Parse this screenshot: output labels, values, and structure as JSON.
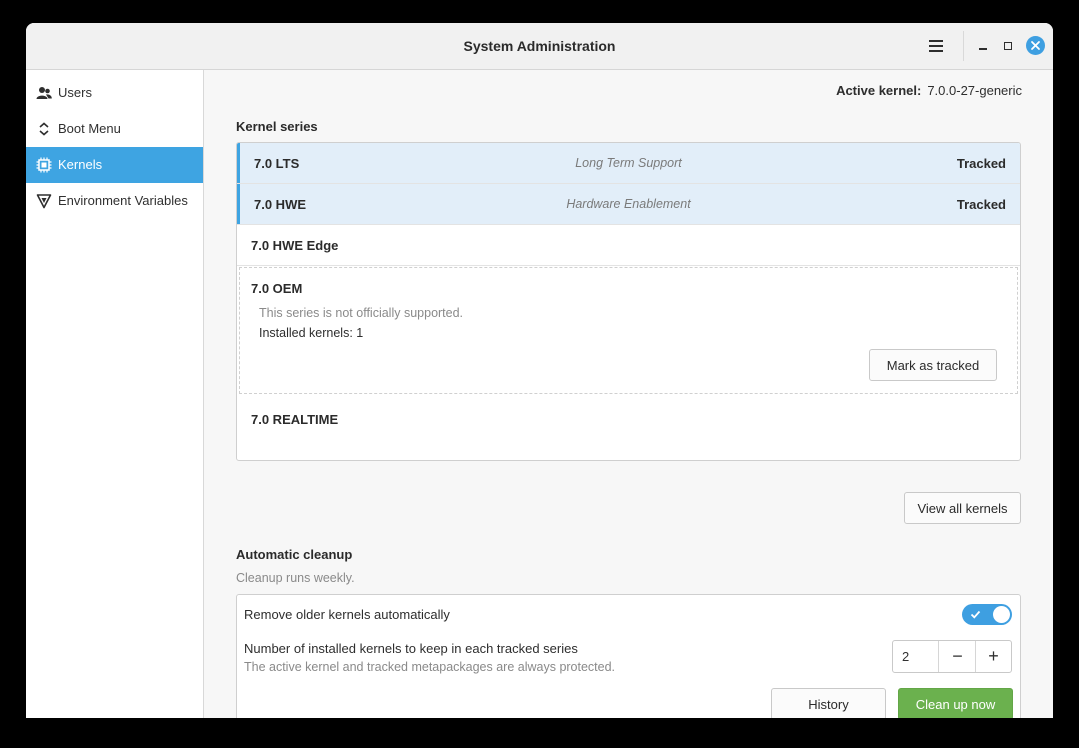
{
  "window": {
    "title": "System Administration"
  },
  "sidebar": {
    "items": [
      {
        "label": "Users",
        "icon": "users-icon",
        "active": false
      },
      {
        "label": "Boot Menu",
        "icon": "boot-menu-icon",
        "active": false
      },
      {
        "label": "Kernels",
        "icon": "chip-icon",
        "active": true
      },
      {
        "label": "Environment Variables",
        "icon": "variables-icon",
        "active": false
      }
    ]
  },
  "main": {
    "active_kernel_label": "Active kernel:",
    "active_kernel_value": "7.0.0-27-generic",
    "kernel_series_title": "Kernel series",
    "series": [
      {
        "name": "7.0 LTS",
        "description": "Long Term Support",
        "status": "Tracked"
      },
      {
        "name": "7.0 HWE",
        "description": "Hardware Enablement",
        "status": "Tracked"
      },
      {
        "name": "7.0 HWE Edge",
        "description": "",
        "status": ""
      },
      {
        "name": "7.0 OEM",
        "note": "This series is not officially supported.",
        "installed": "Installed kernels: 1",
        "action": "Mark as tracked"
      },
      {
        "name": "7.0 REALTIME",
        "description": "",
        "status": ""
      }
    ],
    "view_all_label": "View all kernels",
    "cleanup": {
      "title": "Automatic cleanup",
      "subtitle": "Cleanup runs weekly.",
      "remove_label": "Remove older kernels automatically",
      "remove_enabled": true,
      "keep_label": "Number of installed kernels to keep in each tracked series",
      "keep_hint": "The active kernel and tracked metapackages are always protected.",
      "keep_value": "2",
      "history_label": "History",
      "clean_label": "Clean up now"
    }
  },
  "colors": {
    "accent": "#3ea4e2",
    "success": "#6bb14e",
    "tracked_bg": "#e2eef9"
  }
}
